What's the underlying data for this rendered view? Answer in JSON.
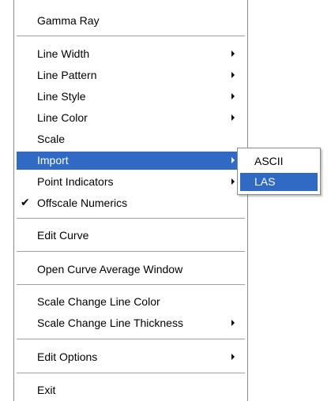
{
  "menu": {
    "items": [
      {
        "label": "Gamma Ray"
      },
      {
        "label": "Line Width"
      },
      {
        "label": "Line Pattern"
      },
      {
        "label": "Line Style"
      },
      {
        "label": "Line Color"
      },
      {
        "label": "Scale"
      },
      {
        "label": "Import"
      },
      {
        "label": "Point Indicators"
      },
      {
        "label": "Offscale Numerics",
        "check": "✔"
      },
      {
        "label": "Edit Curve"
      },
      {
        "label": "Open Curve Average Window"
      },
      {
        "label": "Scale Change Line Color"
      },
      {
        "label": "Scale Change Line Thickness"
      },
      {
        "label": "Edit Options"
      },
      {
        "label": "Exit"
      }
    ]
  },
  "submenu": {
    "items": [
      {
        "label": "ASCII"
      },
      {
        "label": "LAS"
      }
    ]
  },
  "colors": {
    "highlight": "#316ac5",
    "highlight_text": "#ffffff",
    "menu_background": "#ffffff",
    "border": "#8a8a8a"
  },
  "icons": {
    "submenu_arrow": "chevron-right-icon",
    "checkmark": "checkmark-icon"
  }
}
